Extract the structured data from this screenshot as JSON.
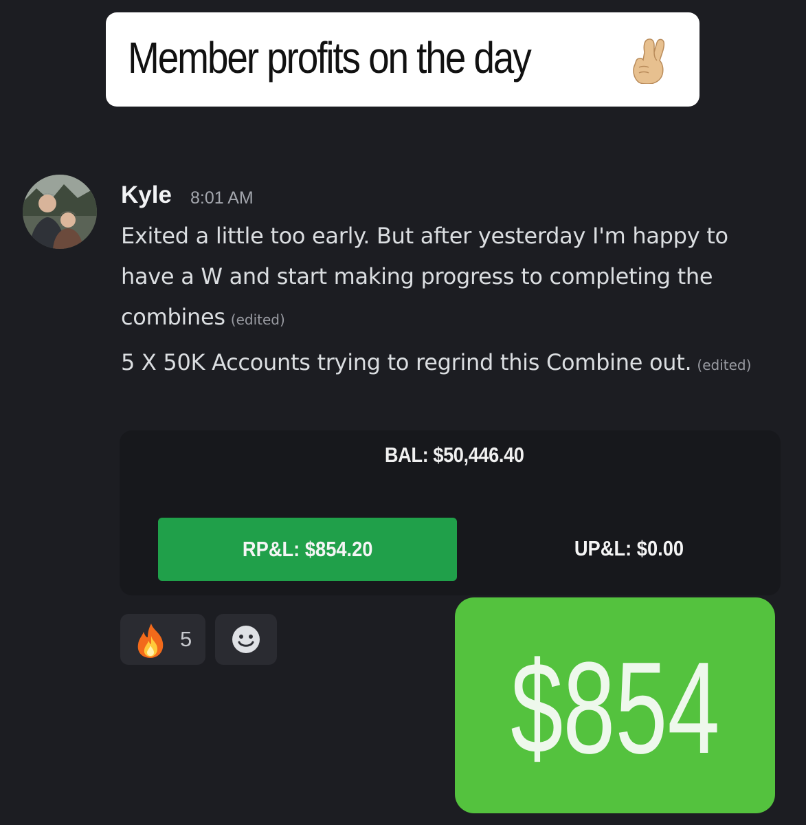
{
  "banner": {
    "title": "Member profits on the day",
    "emoji": "crossed-fingers"
  },
  "message": {
    "author": "Kyle",
    "time": "8:01 AM",
    "paragraph1": "Exited a little too early. But after yesterday I'm happy to have a W and start making progress to completing the combines",
    "paragraph1_edited": "(edited)",
    "paragraph2": "5 X 50K Accounts trying to regrind this Combine out.",
    "paragraph2_edited": "(edited)"
  },
  "embed": {
    "balance": "BAL: $50,446.40",
    "realized": "RP&L: $854.20",
    "unrealized": "UP&L: $0.00",
    "realized_color": "#20a04a"
  },
  "reactions": [
    {
      "emoji": "fire",
      "count": "5"
    }
  ],
  "highlight": {
    "amount": "$854",
    "color": "#54c23e"
  }
}
